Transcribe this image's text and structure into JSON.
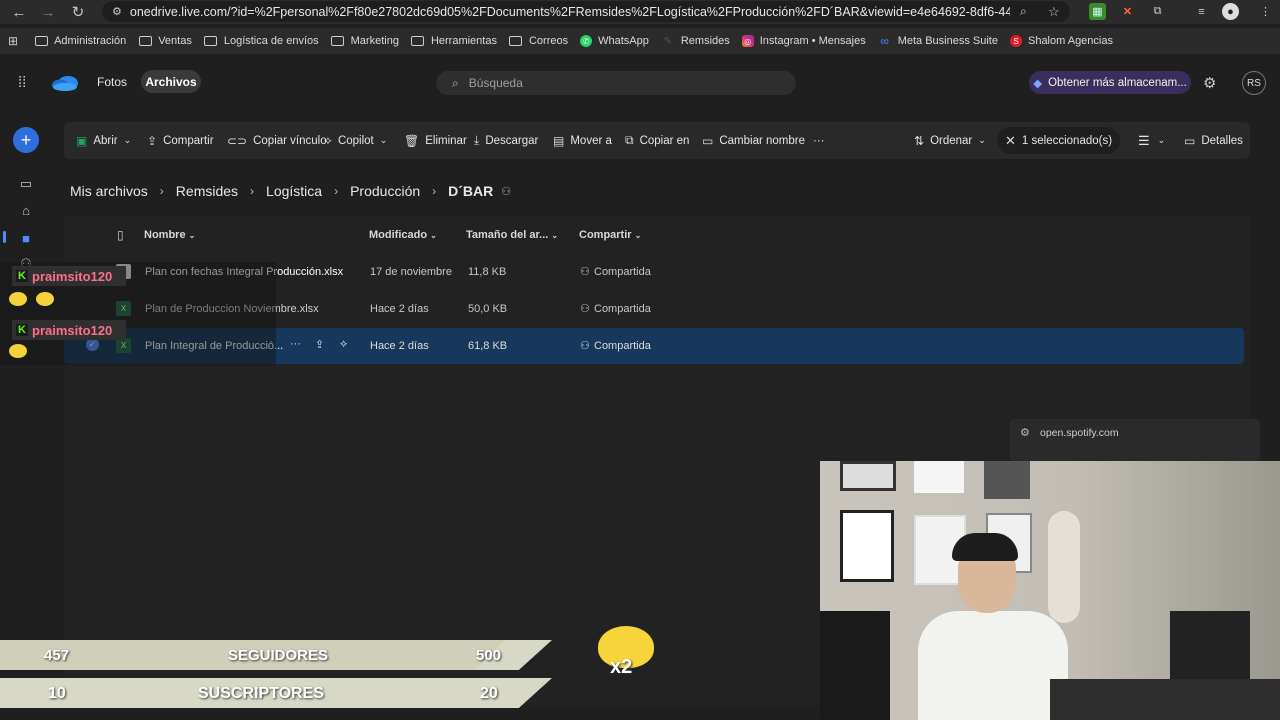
{
  "browser": {
    "url": "onedrive.live.com/?id=%2Fpersonal%2Ff80e27802dc69d05%2FDocuments%2FRemsides%2FLogística%2FProducción%2FD´BAR&viewid=e4e64692-8df6-4496-9bbf-50c9...",
    "bookmarks": [
      "Administración",
      "Ventas",
      "Logística de envíos",
      "Marketing",
      "Herramientas",
      "Correos",
      "WhatsApp",
      "Remsides",
      "Instagram • Mensajes",
      "Meta Business Suite",
      "Shalom Agencias"
    ]
  },
  "header": {
    "tab_photos": "Fotos",
    "tab_files": "Archivos",
    "search_placeholder": "Búsqueda",
    "storage_button": "Obtener más almacenam...",
    "avatar_initials": "RS"
  },
  "commandbar": {
    "open": "Abrir",
    "share": "Compartir",
    "copy_link": "Copiar vínculo",
    "copilot": "Copilot",
    "delete": "Eliminar",
    "download": "Descargar",
    "move_to": "Mover a",
    "copy_to": "Copiar en",
    "rename": "Cambiar nombre",
    "more": "···",
    "sort": "Ordenar",
    "selected": "1 seleccionado(s)",
    "details": "Detalles"
  },
  "breadcrumb": [
    "Mis archivos",
    "Remsides",
    "Logística",
    "Producción",
    "D´BAR"
  ],
  "table": {
    "headers": {
      "name": "Nombre",
      "modified": "Modificado",
      "size": "Tamaño del ar...",
      "sharing": "Compartir"
    },
    "rows": [
      {
        "name": "Plan con fechas Integral Producción.xlsx",
        "modified": "17 de noviembre",
        "size": "11,8 KB",
        "sharing": "Compartida"
      },
      {
        "name": "Plan de Produccion Noviembre.xlsx",
        "modified": "Hace 2 días",
        "size": "50,0 KB",
        "sharing": "Compartida"
      },
      {
        "name": "Plan Integral de Producció...",
        "modified": "Hace 2 días",
        "size": "61,8 KB",
        "sharing": "Compartida"
      }
    ]
  },
  "popup": {
    "text": "open.spotify.com"
  },
  "stream": {
    "chat_user_1": "praimsito120",
    "chat_user_2": "praimsito120",
    "followers": {
      "current": "457",
      "label": "SEGUIDORES",
      "goal": "500"
    },
    "subscribers": {
      "current": "10",
      "label": "SUSCRIPTORES",
      "goal": "20"
    },
    "multiplier": "x2"
  },
  "colors": {
    "accent": "#4f8cff",
    "selected_row": "#17385c",
    "kick_green": "#53fc18",
    "storage_pill": "#3a2f5c"
  }
}
